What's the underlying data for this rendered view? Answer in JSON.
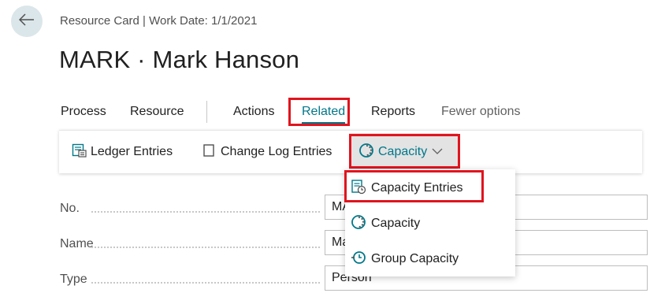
{
  "header": {
    "back_icon": "arrow-left-icon",
    "breadcrumb": "Resource Card | Work Date: 1/1/2021",
    "title": "MARK · Mark Hanson"
  },
  "menu": {
    "items": [
      "Process",
      "Resource",
      "Actions",
      "Related",
      "Reports",
      "Fewer options"
    ],
    "active": "Related"
  },
  "actions": {
    "ledger_entries": "Ledger Entries",
    "change_log_entries": "Change Log Entries",
    "capacity": "Capacity"
  },
  "dropdown": {
    "items": [
      {
        "label": "Capacity Entries",
        "icon": "capacity-entries-icon"
      },
      {
        "label": "Capacity",
        "icon": "capacity-icon"
      },
      {
        "label": "Group Capacity",
        "icon": "group-capacity-icon"
      }
    ]
  },
  "fields": [
    {
      "label": "No.",
      "value": "MA"
    },
    {
      "label": "Name",
      "value": "Ma"
    },
    {
      "label": "Type",
      "value": "Person"
    }
  ],
  "colors": {
    "accent": "#00788a",
    "highlight": "#e0141e"
  }
}
